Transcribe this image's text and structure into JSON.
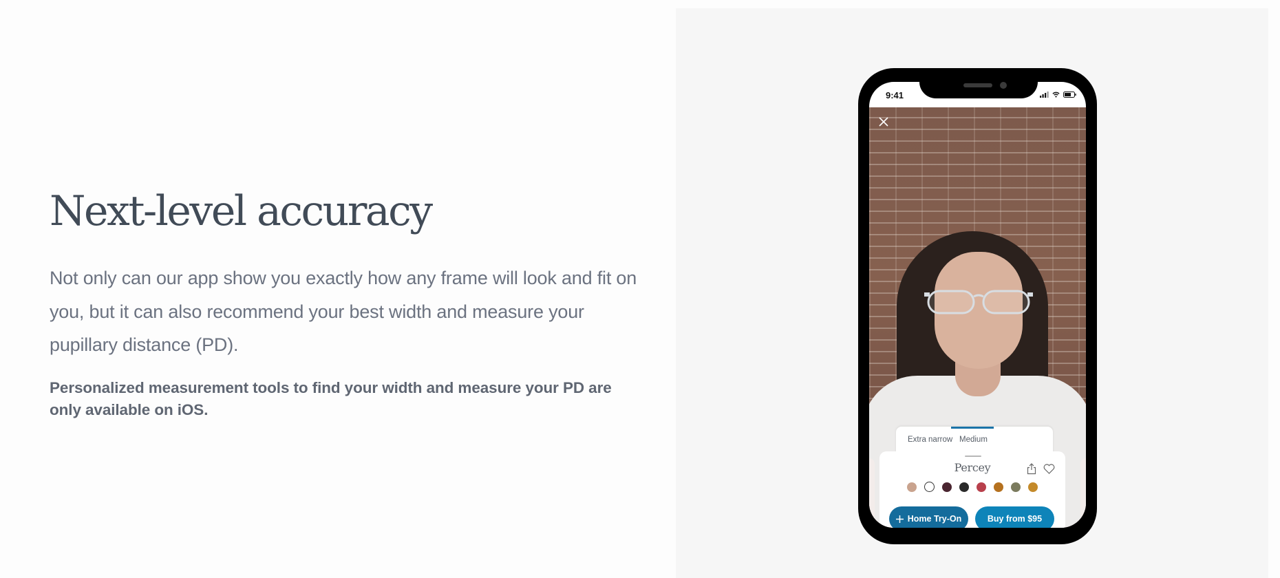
{
  "hero": {
    "title": "Next-level accuracy",
    "body": "Not only can our app show you exactly how any frame will look and fit on you, but it can also recommend your best width and measure your pupillary distance (PD).",
    "note": "Personalized measurement tools to find your width and measure your PD are only available on iOS."
  },
  "phone": {
    "status_time": "9:41",
    "status_icons": [
      "signal-icon",
      "wifi-icon",
      "battery-icon"
    ],
    "close_icon": "close-icon",
    "size_tabs": [
      {
        "label": "Extra narrow",
        "selected": false
      },
      {
        "label": "Medium",
        "selected": true
      }
    ],
    "product": {
      "name": "Percey",
      "share_icon": "share-icon",
      "favorite_icon": "heart-icon",
      "swatches": [
        {
          "color": "#c9a38e",
          "selected": false
        },
        {
          "color": "#ffffff",
          "selected": true
        },
        {
          "color": "#4a2530",
          "selected": false
        },
        {
          "color": "#2a2a2a",
          "selected": false
        },
        {
          "color": "#b8404c",
          "selected": false
        },
        {
          "color": "#b5711f",
          "selected": false
        },
        {
          "color": "#7b7b5e",
          "selected": false
        },
        {
          "color": "#c48a2a",
          "selected": false
        }
      ],
      "home_try_on_label": "Home Try-On",
      "buy_label": "Buy from $95"
    }
  },
  "colors": {
    "primary_dark": "#146c9c",
    "primary": "#0e84b9",
    "heading": "#414b57",
    "text": "#6b7280"
  }
}
